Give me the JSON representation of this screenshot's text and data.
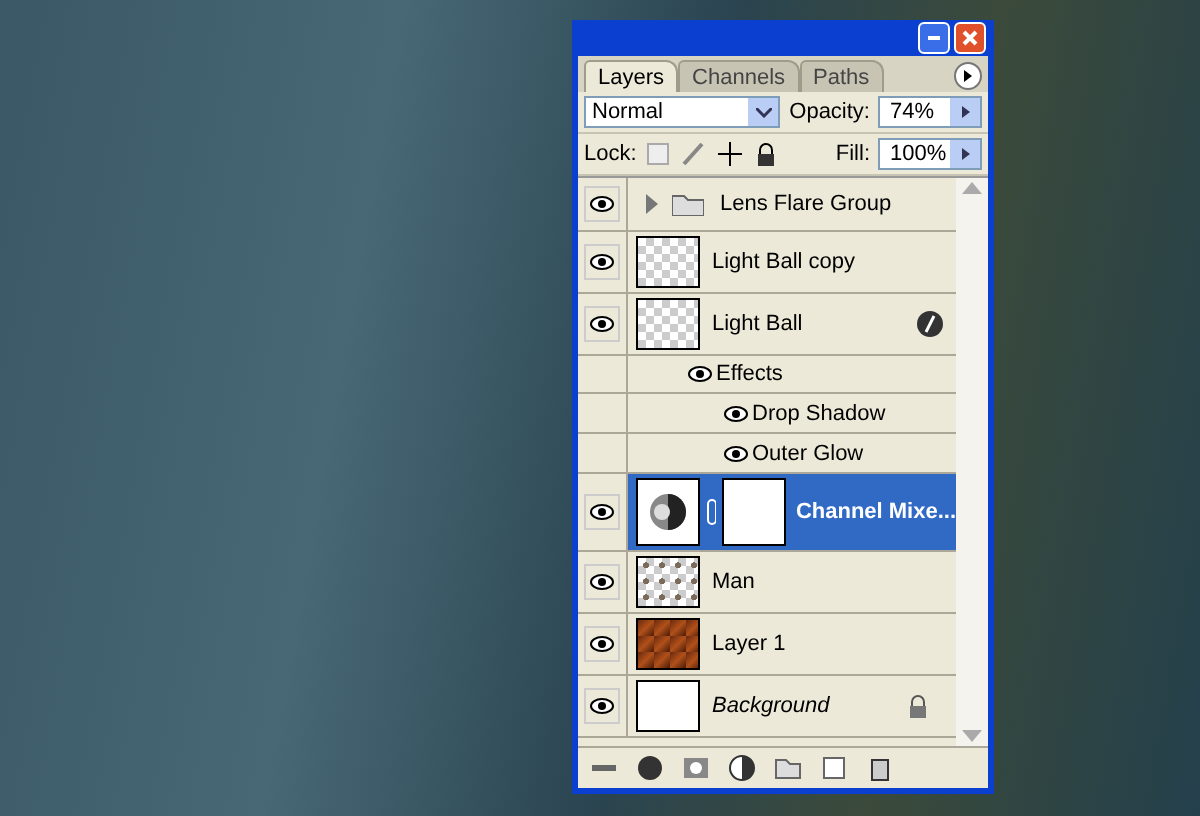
{
  "tabs": [
    {
      "label": "Layers",
      "selected": true
    },
    {
      "label": "Channels",
      "selected": false
    },
    {
      "label": "Paths",
      "selected": false
    }
  ],
  "blend_mode": "Normal",
  "opacity_label": "Opacity:",
  "opacity": "74%",
  "lock_label": "Lock:",
  "fill_label": "Fill:",
  "fill": "100%",
  "layers": [
    {
      "kind": "group",
      "name": "Lens Flare Group",
      "visible": true,
      "selected": false,
      "expanded": false
    },
    {
      "kind": "layer",
      "name": "Light Ball copy",
      "thumbnail": {
        "kind": "transparent"
      },
      "visible": true,
      "selected": false
    },
    {
      "kind": "layer",
      "name": "Light Ball",
      "thumbnail": {
        "kind": "transparent"
      },
      "visible": true,
      "selected": false,
      "fx": true,
      "effects": {
        "label": "Effects",
        "visible": true,
        "items": [
          {
            "name": "Drop Shadow",
            "visible": true
          },
          {
            "name": "Outer Glow",
            "visible": true
          }
        ]
      }
    },
    {
      "kind": "adjustment",
      "name": "Channel Mixe...",
      "visible": true,
      "selected": true
    },
    {
      "kind": "layer",
      "name": "Man",
      "thumbnail": {
        "kind": "cutout"
      },
      "visible": true,
      "selected": false
    },
    {
      "kind": "layer",
      "name": "Layer 1",
      "thumbnail": {
        "kind": "photo"
      },
      "visible": true,
      "selected": false
    },
    {
      "kind": "layer",
      "name": "Background",
      "thumbnail": {
        "kind": "white"
      },
      "visible": true,
      "selected": false,
      "locked": true,
      "italic": true
    }
  ]
}
